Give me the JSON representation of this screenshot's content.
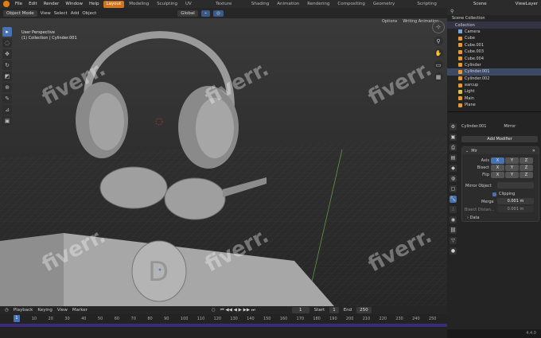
{
  "topbar": {
    "menus": [
      "File",
      "Edit",
      "Render",
      "Window",
      "Help"
    ],
    "workspaces": [
      "Layout",
      "Modeling",
      "Sculpting",
      "UV Editing",
      "Texture Paint",
      "Shading",
      "Animation",
      "Rendering",
      "Compositing",
      "Geometry Nodes",
      "Scripting"
    ],
    "scene": "Scene",
    "view_layer": "ViewLayer"
  },
  "header": {
    "mode": "Object Mode",
    "view": "View",
    "select": "Select",
    "add": "Add",
    "object": "Object",
    "orientation": "Global",
    "options": "Options",
    "writing": "Writing Animation"
  },
  "viewport": {
    "perspective": "User Perspective",
    "collection": "(1) Collection | Cylinder.001",
    "watermark": "fiverr."
  },
  "outliner": {
    "root": "Scene Collection",
    "collection": "Collection",
    "items": [
      "Camera",
      "Cube",
      "Cube.001",
      "Cube.003",
      "Cube.004",
      "Cylinder",
      "Cylinder.001",
      "Cylinder.002",
      "earcup",
      "Light",
      "Main",
      "Plane"
    ]
  },
  "props": {
    "object": "Cylinder.001",
    "modifier_type": "Mirror",
    "add_modifier": "Add Modifier",
    "modifier_name": "Mir",
    "axis_label": "Axis",
    "bisect_label": "Bisect",
    "flip_label": "Flip",
    "x": "X",
    "y": "Y",
    "z": "Z",
    "mirror_object_label": "Mirror Object",
    "clipping": "Clipping",
    "merge_label": "Merge",
    "merge_value": "0.001 m",
    "bisect_distance_label": "Bisect Distan...",
    "bisect_distance_value": "0.001 m",
    "data": "Data"
  },
  "timeline": {
    "playback": "Playback",
    "keying": "Keying",
    "view": "View",
    "marker": "Marker",
    "current": "1",
    "start_label": "Start",
    "start": "1",
    "end_label": "End",
    "end": "250",
    "ticks": [
      "1",
      "10",
      "20",
      "30",
      "40",
      "50",
      "60",
      "70",
      "80",
      "90",
      "100",
      "110",
      "120",
      "130",
      "140",
      "150",
      "160",
      "170",
      "180",
      "190",
      "200",
      "210",
      "220",
      "230",
      "240",
      "250"
    ]
  },
  "status": {
    "version": "4.4.0"
  }
}
